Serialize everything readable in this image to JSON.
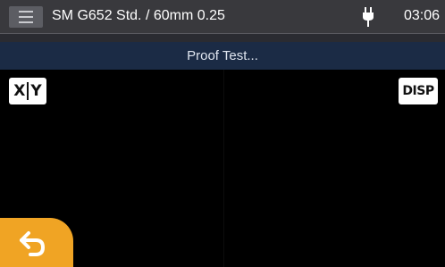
{
  "header": {
    "title": "SM G652 Std. / 60mm 0.25",
    "time": "03:06",
    "power_icon": "plug-icon",
    "menu_icon": "menu-icon"
  },
  "status": {
    "message": "Proof Test..."
  },
  "viewport": {
    "xy_button": {
      "left": "X",
      "right": "Y"
    },
    "disp_button": "DISP"
  },
  "footer": {
    "back_icon": "back-arrow-icon"
  },
  "colors": {
    "topbar": "#39393d",
    "status_bar": "#1b2b45",
    "back_button": "#f0a424",
    "background": "#000000"
  }
}
